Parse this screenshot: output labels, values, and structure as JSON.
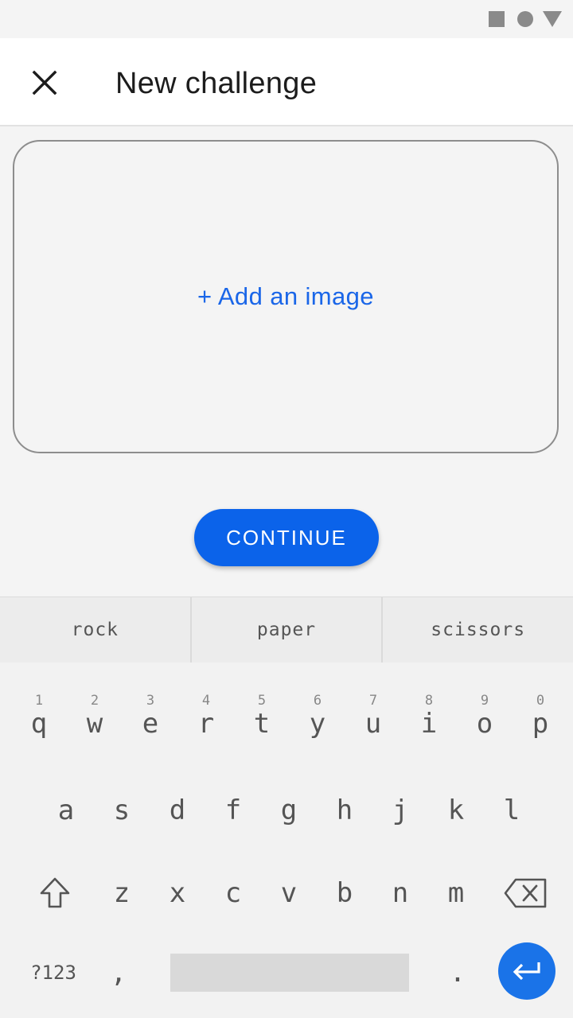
{
  "header": {
    "title": "New challenge"
  },
  "image_card": {
    "label": "+ Add an image"
  },
  "actions": {
    "continue_label": "CONTINUE"
  },
  "colors": {
    "accent": "#0b63ea",
    "link": "#1a66e8",
    "enter": "#1a73e8"
  },
  "keyboard": {
    "suggestions": [
      "rock",
      "paper",
      "scissors"
    ],
    "row1": [
      {
        "k": "q",
        "h": "1"
      },
      {
        "k": "w",
        "h": "2"
      },
      {
        "k": "e",
        "h": "3"
      },
      {
        "k": "r",
        "h": "4"
      },
      {
        "k": "t",
        "h": "5"
      },
      {
        "k": "y",
        "h": "6"
      },
      {
        "k": "u",
        "h": "7"
      },
      {
        "k": "i",
        "h": "8"
      },
      {
        "k": "o",
        "h": "9"
      },
      {
        "k": "p",
        "h": "0"
      }
    ],
    "row2": [
      "a",
      "s",
      "d",
      "f",
      "g",
      "h",
      "j",
      "k",
      "l"
    ],
    "row3": [
      "z",
      "x",
      "c",
      "v",
      "b",
      "n",
      "m"
    ],
    "symbols_label": "?123",
    "comma": ",",
    "period": ".",
    "icons": {
      "shift": "shift-icon",
      "backspace": "backspace-icon",
      "enter": "enter-icon",
      "close": "close-icon"
    }
  }
}
